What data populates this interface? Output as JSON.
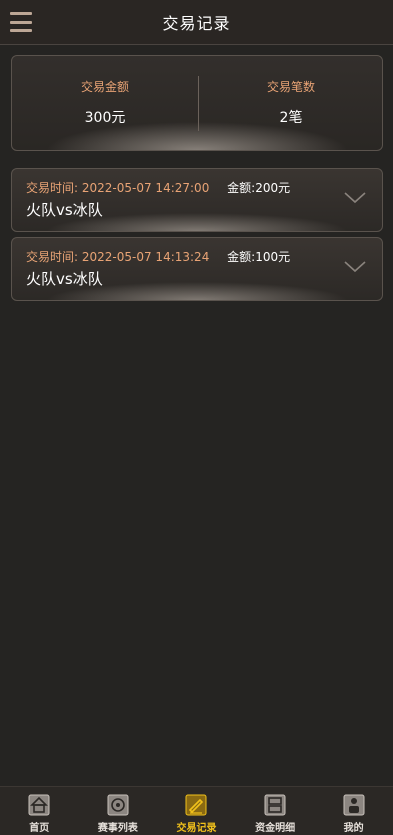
{
  "header": {
    "title": "交易记录",
    "menu_icon": "hamburger-menu-icon"
  },
  "summary": {
    "amount_label": "交易金额",
    "amount_value": "300元",
    "count_label": "交易笔数",
    "count_value": "2笔"
  },
  "records": [
    {
      "time_label": "交易时间:",
      "time": "2022-05-07 14:27:00",
      "amount": "金额:200元",
      "match": "火队vs冰队",
      "icon": "chevron-down-icon"
    },
    {
      "time_label": "交易时间:",
      "time": "2022-05-07 14:13:24",
      "amount": "金额:100元",
      "match": "火队vs冰队",
      "icon": "chevron-down-icon"
    }
  ],
  "tabbar": {
    "active_color": "#f2c21b",
    "items": [
      {
        "label": "首页",
        "icon": "home-icon"
      },
      {
        "label": "赛事列表",
        "icon": "events-icon"
      },
      {
        "label": "交易记录",
        "icon": "trade-record-icon"
      },
      {
        "label": "资金明细",
        "icon": "funds-detail-icon"
      },
      {
        "label": "我的",
        "icon": "profile-icon"
      }
    ]
  }
}
